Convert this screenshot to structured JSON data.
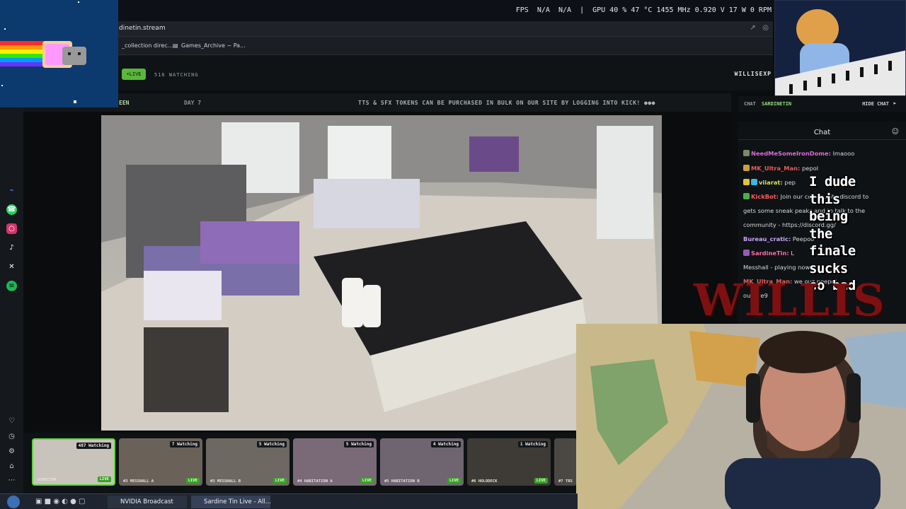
{
  "perf_overlay": {
    "text": "FPS  N/A  N/A  |  GPU 40 % 47 °C 1455 MHz 0.920 V 17 W 0 RPM"
  },
  "browser": {
    "url": "dinetin.stream",
    "bookmarks": [
      "_collection direc...",
      "Games_Archive ~ Pa..."
    ]
  },
  "stream_header": {
    "live_badge": "•LIVE",
    "watching": "516 WATCHING",
    "logo_text": "WILLISEXP"
  },
  "ticker": {
    "left_label": "EEN",
    "day_label": "DAY 7",
    "message": "TTS & SFX TOKENS CAN BE PURCHASED IN BULK ON OUR SITE BY LOGGING INTO KICK! ●●●"
  },
  "chat": {
    "header_label": "CHAT",
    "channel": "SARDINETIN",
    "hide_label": "HIDE CHAT",
    "title": "Chat",
    "messages": [
      {
        "user": "NeedMeSomeIronDome:",
        "text": " lmaooo",
        "color": "#d96bd9"
      },
      {
        "user": "MK_Ultra_Man:",
        "text": " pepoI",
        "color": "#e55c5c"
      },
      {
        "user": "viiarat:",
        "text": " pep",
        "color": "#d4e35a"
      },
      {
        "user": "KickBot:",
        "text": " Join our community discord to",
        "color": "#ff5a5a"
      },
      {
        "user": "",
        "text": "gets some sneak peaks and to talk to the",
        "color": "#d7dbde"
      },
      {
        "user": "",
        "text": "community - https://discord.gg/",
        "color": "#d7dbde"
      },
      {
        "user": "Bureau_cratic:",
        "text": " Peepoo",
        "color": "#c9a3ff"
      },
      {
        "user": "SardineTin:",
        "text": " L",
        "color": "#ff6ba6"
      },
      {
        "user": "",
        "text": "Messhall - playing now",
        "color": "#d7dbde"
      },
      {
        "user": "MK_Ultra_Man:",
        "text": " we ouz peepoI",
        "color": "#e55c5c"
      },
      {
        "user": "",
        "text": "ou rote9",
        "color": "#d7dbde"
      }
    ],
    "overlay_lines": [
      "I dude",
      "this",
      "being",
      "the",
      "finale",
      "sucks",
      "so bad"
    ]
  },
  "branding": {
    "willis_text": "WILLIS"
  },
  "thumbs": [
    {
      "watching": "487 Watching",
      "label": "DIRECTOR",
      "live": "LIVE"
    },
    {
      "watching": "7 Watching",
      "label": "#3 MESSHALL A",
      "live": "LIVE"
    },
    {
      "watching": "5 Watching",
      "label": "#3 MESSHALL B",
      "live": "LIVE"
    },
    {
      "watching": "5 Watching",
      "label": "#4 HABITATION A",
      "live": "LIVE"
    },
    {
      "watching": "4 Watching",
      "label": "#5 HABITATION B",
      "live": "LIVE"
    },
    {
      "watching": "1 Watching",
      "label": "#6 HOLODECK",
      "live": "LIVE"
    },
    {
      "watching": "",
      "label": "#7 TRS",
      "live": ""
    }
  ],
  "taskbar": {
    "items": [
      "NVIDIA Broadcast",
      "Sardine Tin Live - All..."
    ]
  },
  "colors": {
    "accent_green": "#59b73b",
    "willis_red": "#7e1012"
  }
}
